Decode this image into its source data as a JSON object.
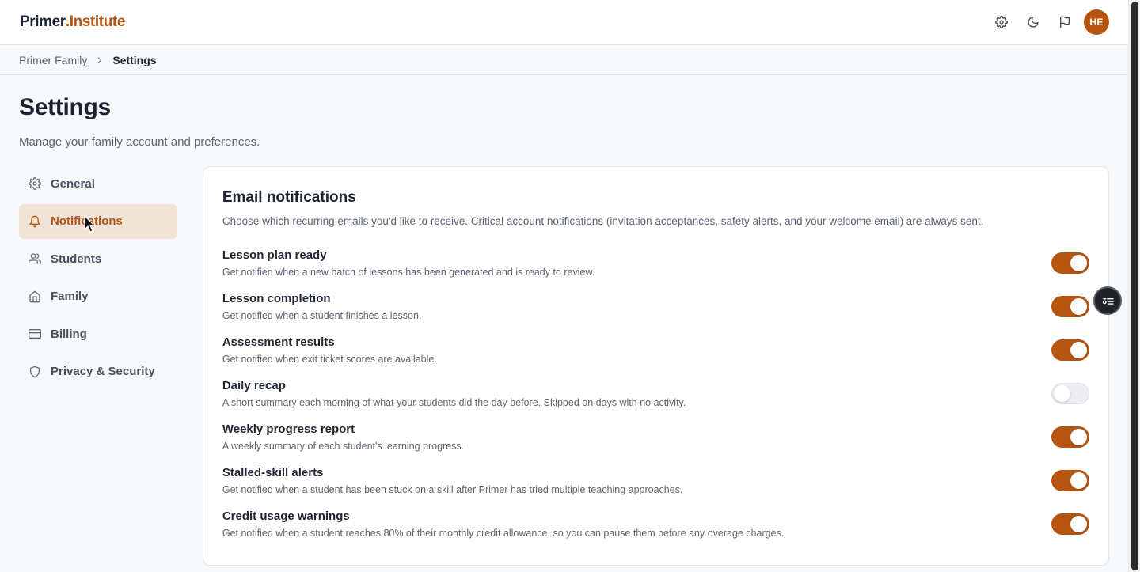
{
  "brand": {
    "primer": "Primer",
    "dot": ".",
    "institute": "Institute",
    "accent_color": "#b75410"
  },
  "header": {
    "icons": [
      "gear-icon",
      "moon-icon",
      "flag-icon"
    ],
    "avatar_initials": "HE"
  },
  "breadcrumb": {
    "parent": "Primer Family",
    "current": "Settings"
  },
  "page": {
    "title": "Settings",
    "subtitle": "Manage your family account and preferences."
  },
  "sidebar": {
    "items": [
      {
        "label": "General",
        "icon": "gear-icon",
        "active": false
      },
      {
        "label": "Notifications",
        "icon": "bell-icon",
        "active": true
      },
      {
        "label": "Students",
        "icon": "users-icon",
        "active": false
      },
      {
        "label": "Family",
        "icon": "home-icon",
        "active": false
      },
      {
        "label": "Billing",
        "icon": "credit-card-icon",
        "active": false
      },
      {
        "label": "Privacy & Security",
        "icon": "shield-icon",
        "active": false
      }
    ]
  },
  "card": {
    "title": "Email notifications",
    "description": "Choose which recurring emails you'd like to receive. Critical account notifications (invitation acceptances, safety alerts, and your welcome email) are always sent.",
    "settings": [
      {
        "title": "Lesson plan ready",
        "description": "Get notified when a new batch of lessons has been generated and is ready to review.",
        "enabled": true
      },
      {
        "title": "Lesson completion",
        "description": "Get notified when a student finishes a lesson.",
        "enabled": true
      },
      {
        "title": "Assessment results",
        "description": "Get notified when exit ticket scores are available.",
        "enabled": true
      },
      {
        "title": "Daily recap",
        "description": "A short summary each morning of what your students did the day before. Skipped on days with no activity.",
        "enabled": false
      },
      {
        "title": "Weekly progress report",
        "description": "A weekly summary of each student's learning progress.",
        "enabled": true
      },
      {
        "title": "Stalled-skill alerts",
        "description": "Get notified when a student has been stuck on a skill after Primer has tried multiple teaching approaches.",
        "enabled": true
      },
      {
        "title": "Credit usage warnings",
        "description": "Get notified when a student reaches 80% of their monthly credit allowance, so you can pause them before any overage charges.",
        "enabled": true
      }
    ]
  }
}
